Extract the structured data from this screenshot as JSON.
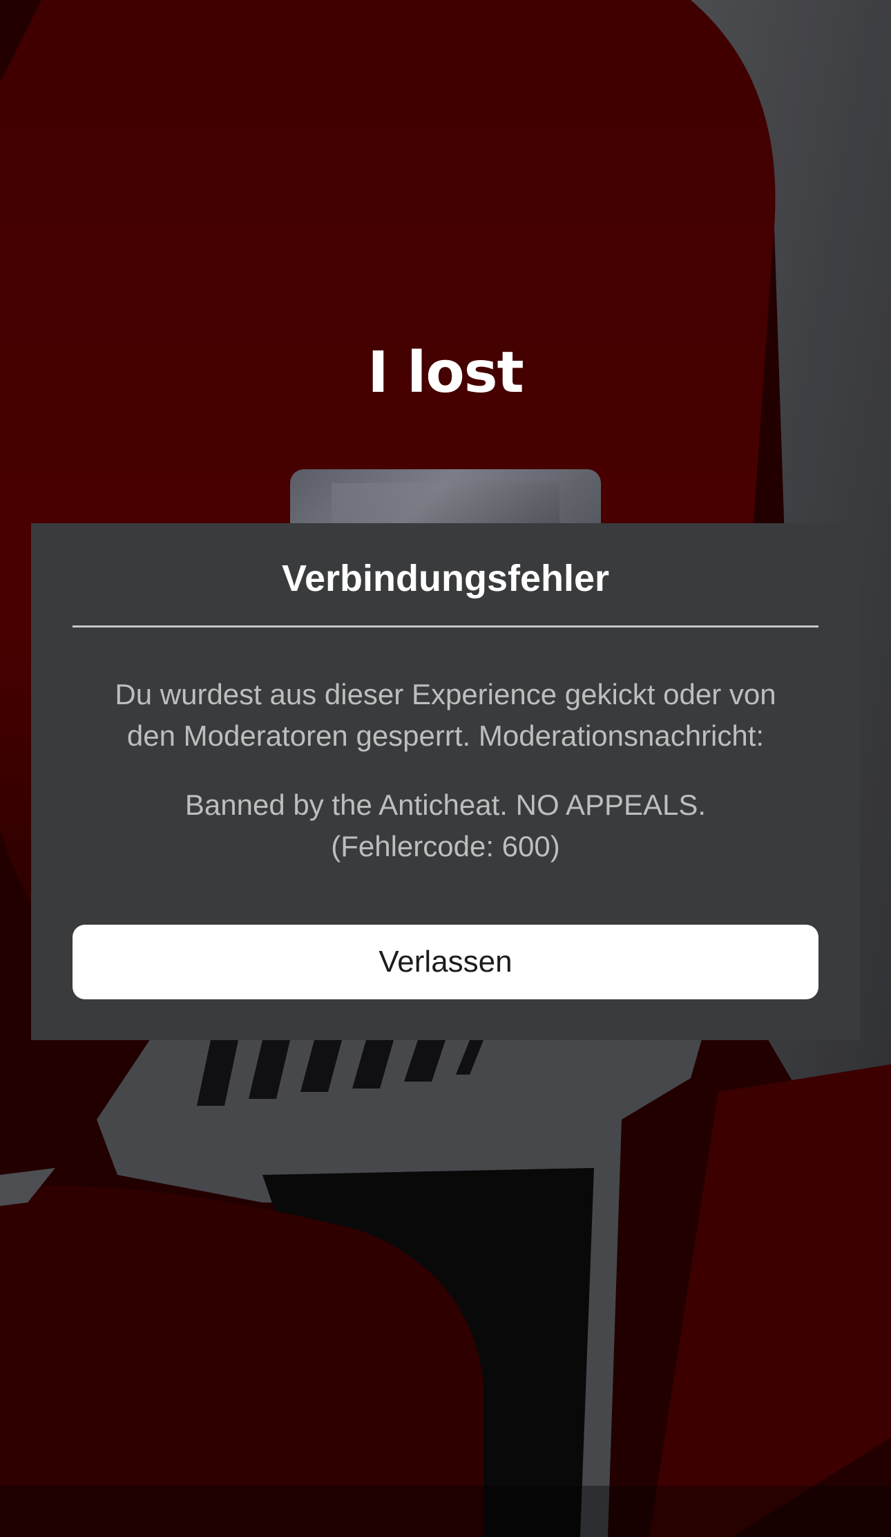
{
  "game": {
    "title": "I lost"
  },
  "dialog": {
    "title": "Verbindungsfehler",
    "message_lines": [
      "Du wurdest aus dieser Experience gekickt oder von",
      "den Moderatoren gesperrt. Moderationsnachricht:",
      "Banned by the Anticheat. NO APPEALS.",
      "(Fehlercode: 600)"
    ],
    "leave_label": "Verlassen"
  },
  "colors": {
    "dialog_background": "#393b3d",
    "button_background": "#ffffff",
    "background_red": "#6b0000"
  }
}
